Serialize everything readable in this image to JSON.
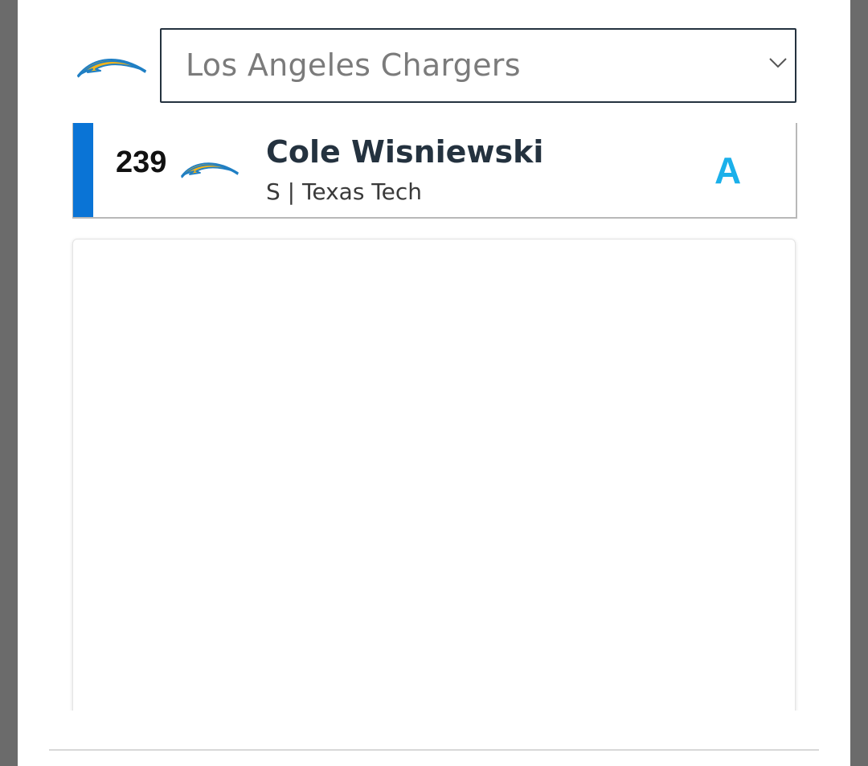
{
  "team_selector": {
    "selected_team": "Los Angeles Chargers",
    "logo": "chargers-bolt-logo",
    "dropdown_icon": "chevron-down-icon"
  },
  "pick_card": {
    "pick_number": "239",
    "team_logo": "chargers-bolt-logo",
    "player_name": "Cole Wisniewski",
    "player_meta": "S | Texas Tech",
    "grade": "A"
  },
  "colors": {
    "accent_bar": "#0a74d6",
    "grade": "#1bb0ea",
    "text_dark": "#24323f",
    "bolt_gold": "#f2b41b",
    "bolt_blue": "#1f7fc4"
  }
}
